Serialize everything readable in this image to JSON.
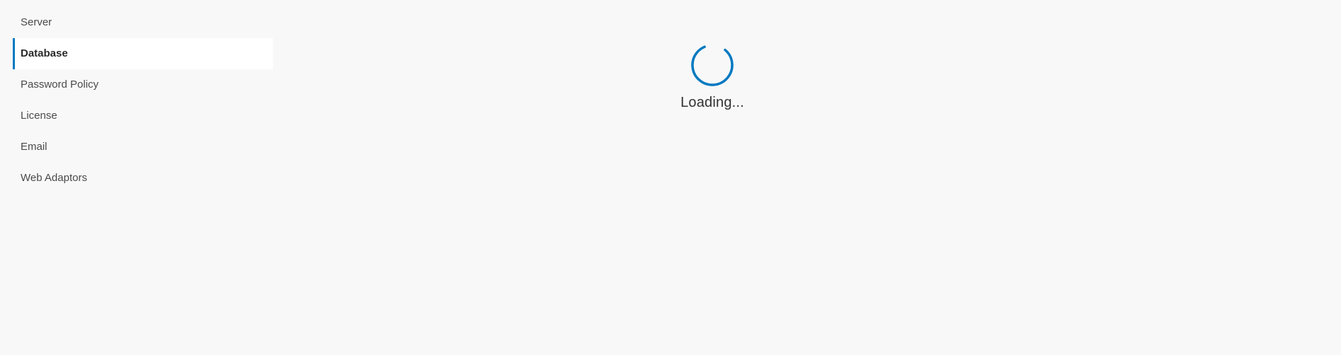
{
  "sidebar": {
    "items": [
      {
        "label": "Server",
        "active": false
      },
      {
        "label": "Database",
        "active": true
      },
      {
        "label": "Password Policy",
        "active": false
      },
      {
        "label": "License",
        "active": false
      },
      {
        "label": "Email",
        "active": false
      },
      {
        "label": "Web Adaptors",
        "active": false
      }
    ]
  },
  "main": {
    "loading_text": "Loading..."
  },
  "icons": {
    "spinner": "loading-spinner-icon"
  },
  "colors": {
    "accent": "#0079c1",
    "background": "#f8f8f8",
    "active_item_bg": "#ffffff"
  }
}
